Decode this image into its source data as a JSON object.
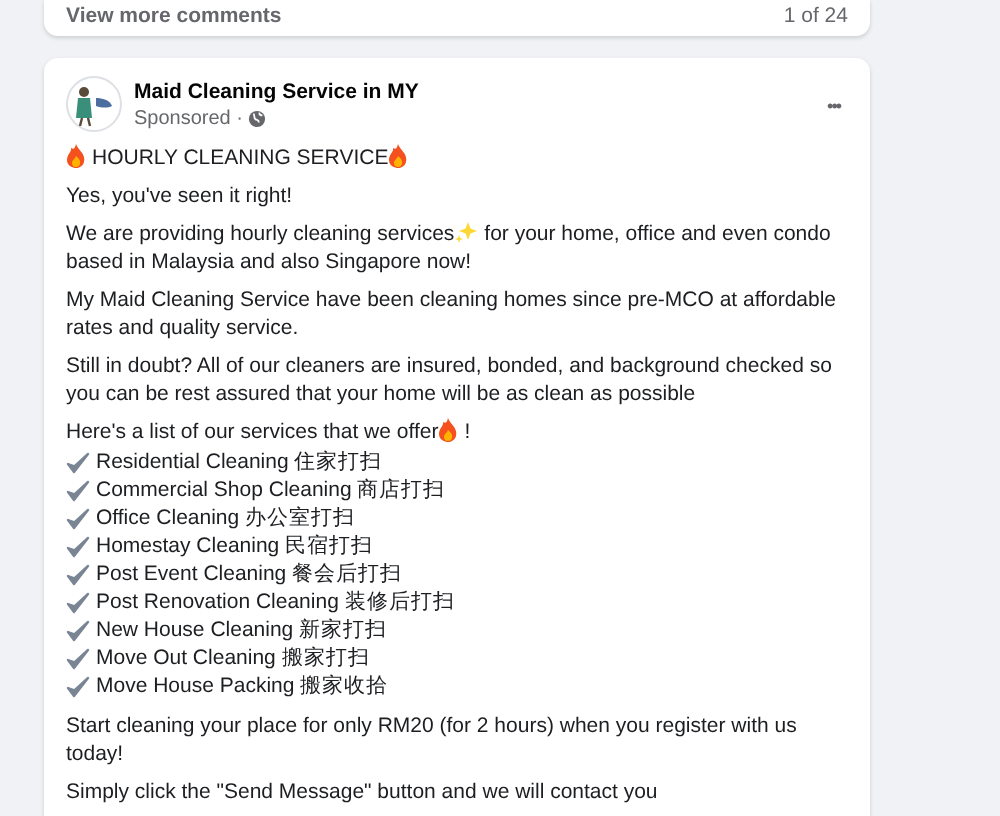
{
  "comments_bar": {
    "link": "View more comments",
    "count": "1 of 24"
  },
  "post": {
    "author": "Maid Cleaning Service in MY",
    "meta": "Sponsored ·",
    "menu": "•••",
    "paragraphs": [
      {
        "parts": [
          {
            "kind": "fire"
          },
          {
            "kind": "text",
            "text": "HOURLY CLEANING SERVICE"
          },
          {
            "kind": "fire"
          }
        ]
      },
      {
        "parts": [
          {
            "kind": "text",
            "text": "Yes, you've seen it right!"
          }
        ]
      },
      {
        "parts": [
          {
            "kind": "text",
            "text": "We are providing hourly cleaning services"
          },
          {
            "kind": "sparkles"
          },
          {
            "kind": "text",
            "text": "for your home, office and even condo based in Malaysia and also Singapore now!"
          }
        ]
      },
      {
        "parts": [
          {
            "kind": "text",
            "text": "My Maid Cleaning Service have been cleaning homes since pre-MCO at affordable rates and quality service."
          }
        ]
      },
      {
        "parts": [
          {
            "kind": "text",
            "text": "Still in doubt? All of our cleaners are insured, bonded, and background checked so you can be rest assured that your home will be as clean as possible"
          }
        ]
      }
    ],
    "list_intro": [
      {
        "kind": "text",
        "text": "Here's a list of our services that we offer"
      },
      {
        "kind": "fire"
      },
      {
        "kind": "text",
        "text": "!"
      }
    ],
    "services": [
      "Residential Cleaning 住家打扫",
      "Commercial Shop Cleaning 商店打扫",
      "Office Cleaning 办公室打扫",
      "Homestay Cleaning 民宿打扫",
      "Post Event Cleaning 餐会后打扫",
      "Post Renovation Cleaning 装修后打扫",
      "New House Cleaning 新家打扫",
      "Move Out Cleaning 搬家打扫",
      "Move House Packing 搬家收拾"
    ],
    "closing": [
      "Start cleaning your place for only RM20 (for 2 hours) when you register with us today!",
      "Simply click the \"Send Message\" button and we will contact you"
    ]
  }
}
